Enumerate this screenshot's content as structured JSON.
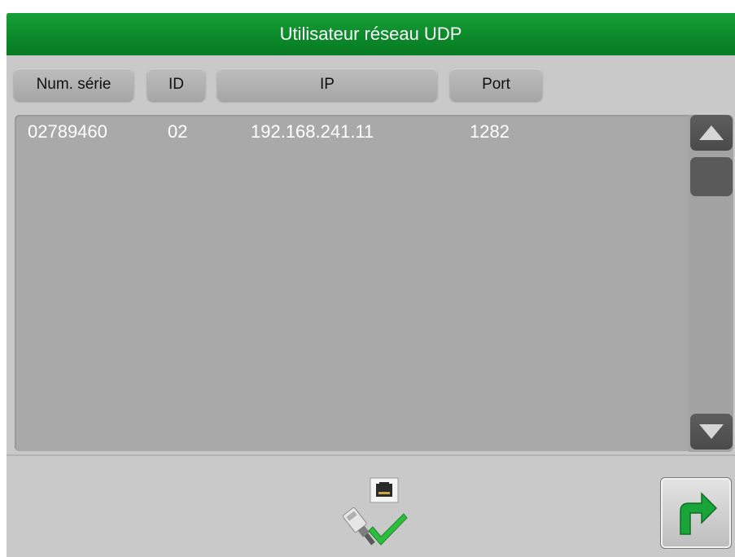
{
  "window": {
    "title": "Utilisateur réseau UDP"
  },
  "columns": [
    "Num. série",
    "ID",
    "IP",
    "Port"
  ],
  "rows": [
    {
      "serial": "02789460",
      "id": "02",
      "ip": "192.168.241.11",
      "port": "1282"
    }
  ],
  "icons": {
    "scroll_up": "triangle-up-icon",
    "scroll_down": "triangle-down-icon",
    "network": "network-cable-connected-icon",
    "next": "arrow-turn-right-icon"
  },
  "colors": {
    "title_bar": "#0b8a2a",
    "next_arrow": "#1aa53a",
    "check": "#2ebc3e"
  }
}
